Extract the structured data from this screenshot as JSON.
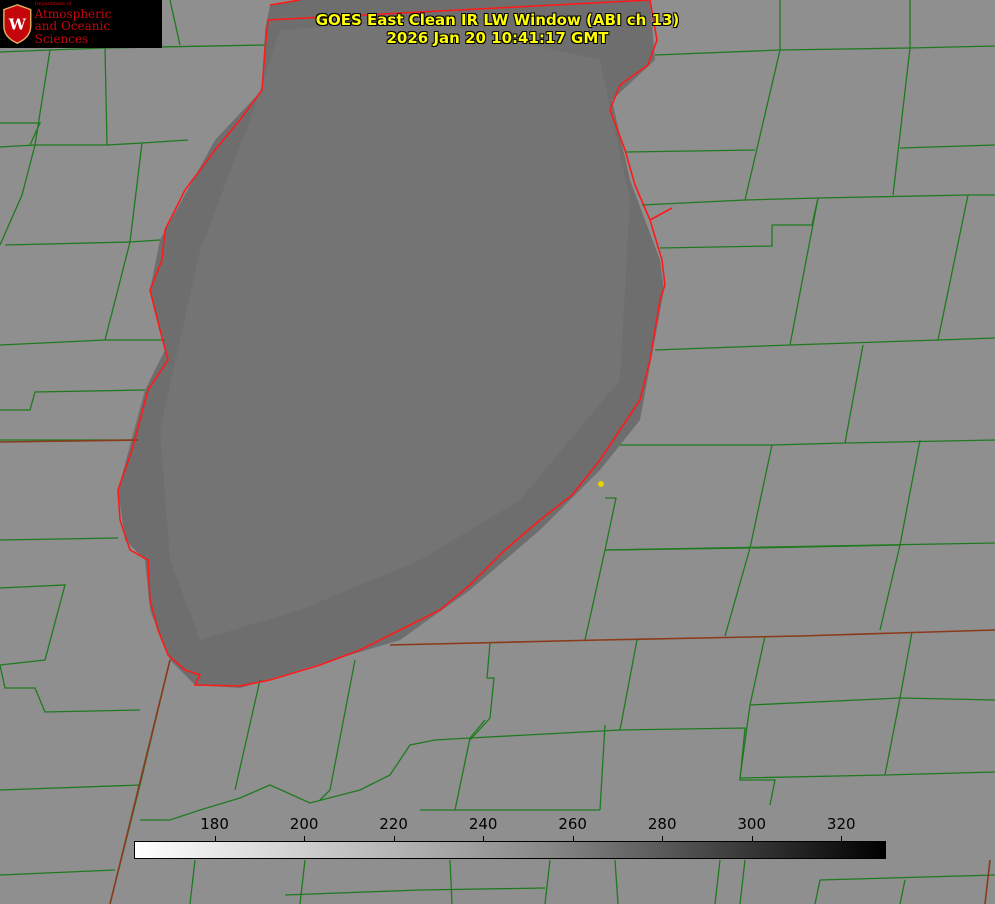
{
  "title_line1": "GOES East Clean IR LW Window (ABI ch 13)",
  "title_line2": "2026 Jan 20 10:41:17 GMT",
  "logo": {
    "dept": "Department of",
    "line1": "Atmospheric",
    "line2": "and Oceanic Sciences",
    "letter": "W"
  },
  "colorbar": {
    "min": 162,
    "max": 330,
    "ticks": [
      "180",
      "200",
      "220",
      "240",
      "260",
      "280",
      "300",
      "320"
    ]
  },
  "colors": {
    "county_lines": "#1f7a1f",
    "state_lines": "#8b3a1a",
    "coastline": "#ff1a1a",
    "title": "#ffff00",
    "marker": "#e8d000"
  }
}
